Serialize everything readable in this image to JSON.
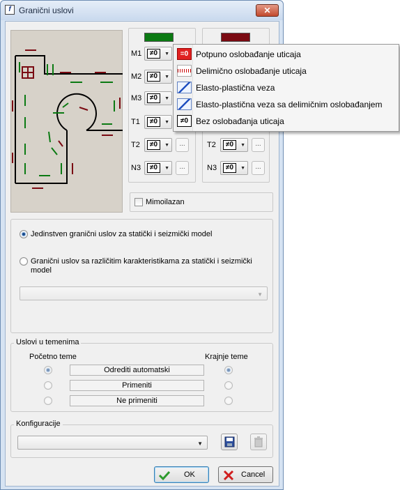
{
  "window": {
    "title": "Granični uslovi",
    "close_label": "✕",
    "app_icon": "f"
  },
  "colors": {
    "start_swatch": "#0b7a13",
    "end_swatch": "#7a0a12",
    "title_bar": "#c9d9ee",
    "close_button": "#c24a2e",
    "preview_bg": "#d7d2c9"
  },
  "left_panel": {
    "rows": [
      {
        "label": "M1",
        "symbol": "≠0"
      },
      {
        "label": "M2",
        "symbol": "≠0"
      },
      {
        "label": "M3",
        "symbol": "≠0"
      },
      {
        "label": "T1",
        "symbol": "≠0"
      },
      {
        "label": "T2",
        "symbol": "≠0"
      },
      {
        "label": "N3",
        "symbol": "≠0"
      }
    ],
    "dots_label": "..."
  },
  "right_panel": {
    "rows": [
      {
        "label": "T2",
        "symbol": "≠0"
      },
      {
        "label": "N3",
        "symbol": "≠0"
      }
    ],
    "dots_label": "..."
  },
  "mimoilazan": {
    "label": "Mimoilazan",
    "checked": false
  },
  "model_options": {
    "option1": "Jedinstven granični uslov za statički i seizmički model",
    "option2": "Granični uslov sa različitim karakteristikama za statički i seizmički model",
    "selected": 1,
    "combo_value": ""
  },
  "uslovi": {
    "legend": "Uslovi u temenima",
    "start_header": "Početno teme",
    "end_header": "Krajnje teme",
    "options": [
      "Odrediti automatski",
      "Primeniti",
      "Ne primeniti"
    ]
  },
  "konfiguracije": {
    "legend": "Konfiguracije",
    "value": ""
  },
  "buttons": {
    "ok": "OK",
    "cancel": "Cancel"
  },
  "popup_menu": {
    "items": [
      {
        "label": "Potpuno oslobađanje uticaja",
        "icon": "full-release-icon",
        "symbol": "=0"
      },
      {
        "label": "Delimično oslobađanje uticaja",
        "icon": "partial-release-icon",
        "symbol": ""
      },
      {
        "label": "Elasto-plastična veza",
        "icon": "elasto-plastic-icon",
        "symbol": ""
      },
      {
        "label": "Elasto-plastična veza sa delimičnim oslobađanjem",
        "icon": "elasto-plastic-partial-icon",
        "symbol": ""
      },
      {
        "label": "Bez oslobađanja uticaja",
        "icon": "no-release-icon",
        "symbol": "≠0"
      }
    ]
  }
}
